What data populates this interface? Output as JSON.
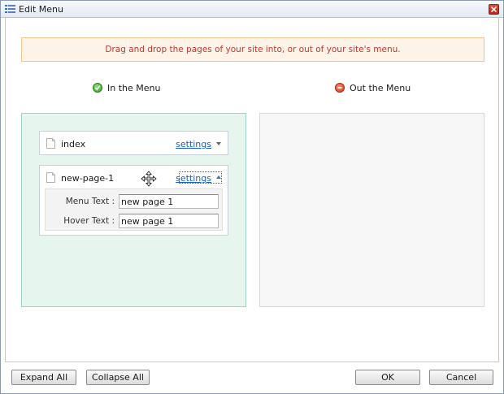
{
  "window": {
    "title": "Edit Menu"
  },
  "notice": "Drag and drop the pages of your site into, or out of your site's menu.",
  "headings": {
    "in_menu": "In the Menu",
    "out_menu": "Out the Menu"
  },
  "in_menu_pages": [
    {
      "name": "index",
      "settings_label": "settings",
      "expanded": false
    },
    {
      "name": "new-page-1",
      "settings_label": "settings",
      "expanded": true,
      "menu_text_label": "Menu Text :",
      "menu_text_value": "new page 1",
      "hover_text_label": "Hover Text :",
      "hover_text_value": "new page 1"
    }
  ],
  "out_menu_pages": [],
  "footer": {
    "expand_all": "Expand All",
    "collapse_all": "Collapse All",
    "ok": "OK",
    "cancel": "Cancel"
  },
  "colors": {
    "notice_text": "#c0392b",
    "notice_bg": "#fdf3e8",
    "in_panel_bg": "#e6f6ef",
    "out_panel_bg": "#f7f7f7",
    "link": "#1a5fbf"
  },
  "icons": {
    "title": "menu-list-icon",
    "close": "close-icon",
    "in_menu": "check-circle-icon",
    "out_menu": "minus-circle-icon",
    "page": "page-icon",
    "move": "move-cursor-icon"
  }
}
